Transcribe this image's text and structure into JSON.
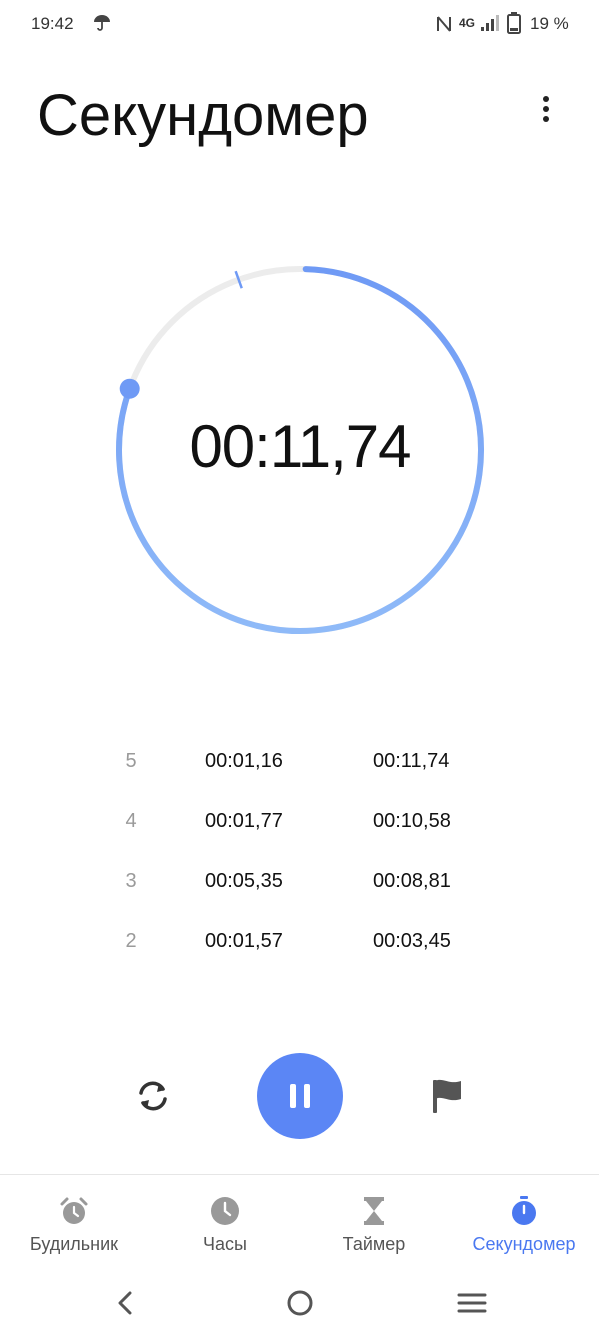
{
  "status_bar": {
    "time": "19:42",
    "network": "4G",
    "battery": "19 %",
    "icons": [
      "umbrella-icon",
      "nfc-icon",
      "signal-icon",
      "battery-icon"
    ]
  },
  "header": {
    "title": "Секундомер",
    "menu_icon": "more-vert-icon"
  },
  "stopwatch": {
    "elapsed": "00:11,74",
    "progress_fraction": 0.2
  },
  "laps": [
    {
      "number": "5",
      "split": "00:01,16",
      "total": "00:11,74"
    },
    {
      "number": "4",
      "split": "00:01,77",
      "total": "00:10,58"
    },
    {
      "number": "3",
      "split": "00:05,35",
      "total": "00:08,81"
    },
    {
      "number": "2",
      "split": "00:01,57",
      "total": "00:03,45"
    }
  ],
  "controls": {
    "reset_icon": "reset-icon",
    "pause_icon": "pause-icon",
    "lap_icon": "flag-icon"
  },
  "tabs": [
    {
      "label": "Будильник",
      "icon": "alarm-icon",
      "active": false
    },
    {
      "label": "Часы",
      "icon": "clock-icon",
      "active": false
    },
    {
      "label": "Таймер",
      "icon": "hourglass-icon",
      "active": false
    },
    {
      "label": "Секундомер",
      "icon": "stopwatch-icon",
      "active": true
    }
  ],
  "nav": {
    "icons": [
      "back-icon",
      "home-icon",
      "recents-icon"
    ]
  },
  "colors": {
    "accent": "#4a78f0",
    "pause_button": "#5b86f5",
    "ring_track": "#ececec",
    "ring_progress_start": "#6f9af5",
    "ring_progress_end": "#8fbaf8"
  }
}
